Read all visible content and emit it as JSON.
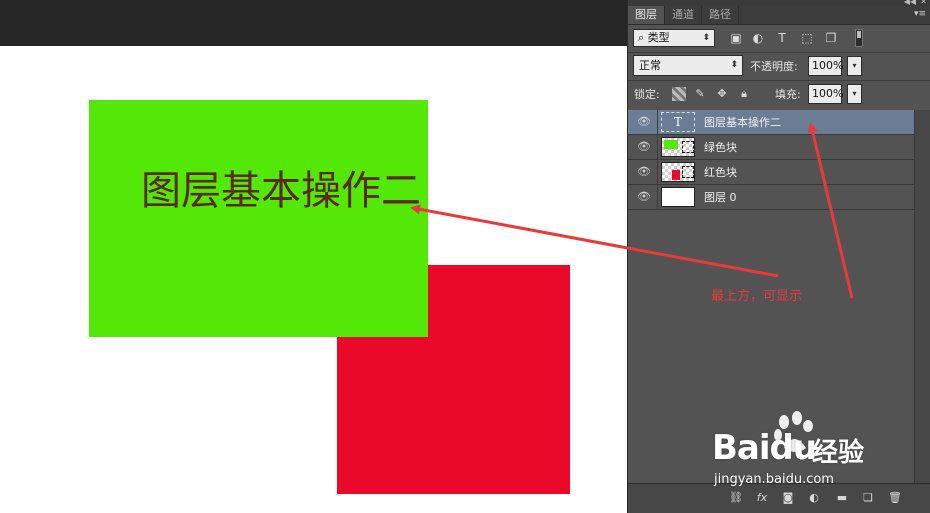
{
  "canvas": {
    "text_layer": "图层基本操作二",
    "green_color": "#53e808",
    "red_color": "#e80a28"
  },
  "panel": {
    "tabs": [
      {
        "label": "图层",
        "active": true
      },
      {
        "label": "通道",
        "active": false
      },
      {
        "label": "路径",
        "active": false
      }
    ],
    "filter": {
      "label": "类型",
      "icons": [
        "image-filter-icon",
        "adjustment-filter-icon",
        "type-filter-icon",
        "shape-filter-icon",
        "smart-object-filter-icon"
      ]
    },
    "blend_mode": "正常",
    "opacity_label": "不透明度:",
    "opacity_value": "100%",
    "lock_label": "锁定:",
    "fill_label": "填充:",
    "fill_value": "100%",
    "layers": [
      {
        "name": "图层基本操作二",
        "kind": "text",
        "selected": true
      },
      {
        "name": "绿色块",
        "kind": "green",
        "selected": false
      },
      {
        "name": "红色块",
        "kind": "red",
        "selected": false
      },
      {
        "name": "图层 0",
        "kind": "white",
        "selected": false
      }
    ],
    "bottom_icons": [
      "link-layers-icon",
      "fx-icon",
      "add-mask-icon",
      "adjustment-layer-icon",
      "new-group-icon",
      "new-layer-icon",
      "delete-layer-icon"
    ]
  },
  "annotation": {
    "text": "最上方，可显示",
    "color": "#e83a3a"
  },
  "watermark": {
    "brand": "Baidu",
    "chinese": "经验",
    "url": "jingyan.baidu.com"
  }
}
